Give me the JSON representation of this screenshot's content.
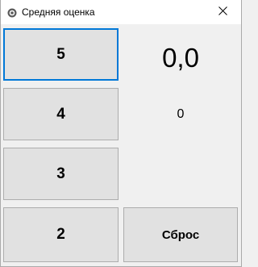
{
  "window": {
    "title": "Средняя оценка",
    "icon": "app-icon",
    "close_glyph": "✕"
  },
  "grade_buttons": [
    {
      "label": "5"
    },
    {
      "label": "4"
    },
    {
      "label": "3"
    },
    {
      "label": "2"
    }
  ],
  "display": {
    "average": "0,0",
    "count": "0"
  },
  "reset_button": {
    "label": "Сброс"
  },
  "colors": {
    "focus_border": "#0078d7",
    "button_bg": "#e1e1e1",
    "button_border": "#adadad",
    "window_bg": "#f0f0f0"
  }
}
